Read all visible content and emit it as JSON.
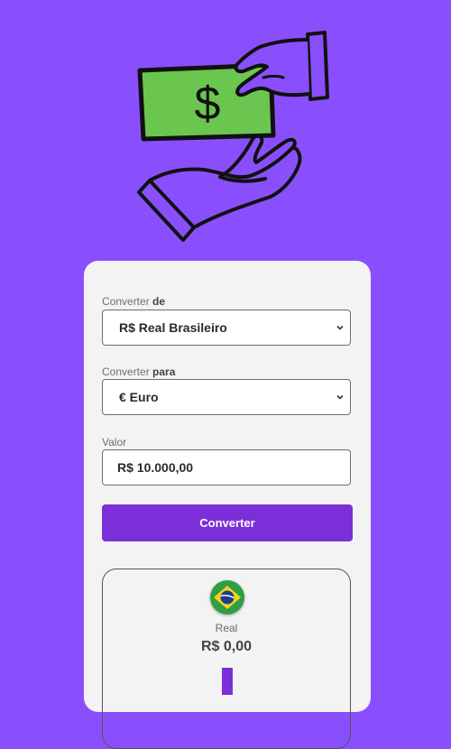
{
  "hero": {
    "icon": "money-exchange-illustration",
    "symbol": "$"
  },
  "form": {
    "from_label_prefix": "Converter",
    "from_label_bold": "de",
    "from_value": "R$ Real Brasileiro",
    "to_label_prefix": "Converter",
    "to_label_bold": "para",
    "to_value": "€ Euro",
    "amount_label": "Valor",
    "amount_value": "R$ 10.000,00",
    "convert_button": "Converter"
  },
  "result": {
    "flag_icon": "brazil-flag-icon",
    "currency_name": "Real",
    "currency_value": "R$ 0,00"
  },
  "colors": {
    "background": "#8a4ffc",
    "card": "#f3f3f3",
    "accent": "#7b2fd8",
    "money": "#6ac64f"
  }
}
